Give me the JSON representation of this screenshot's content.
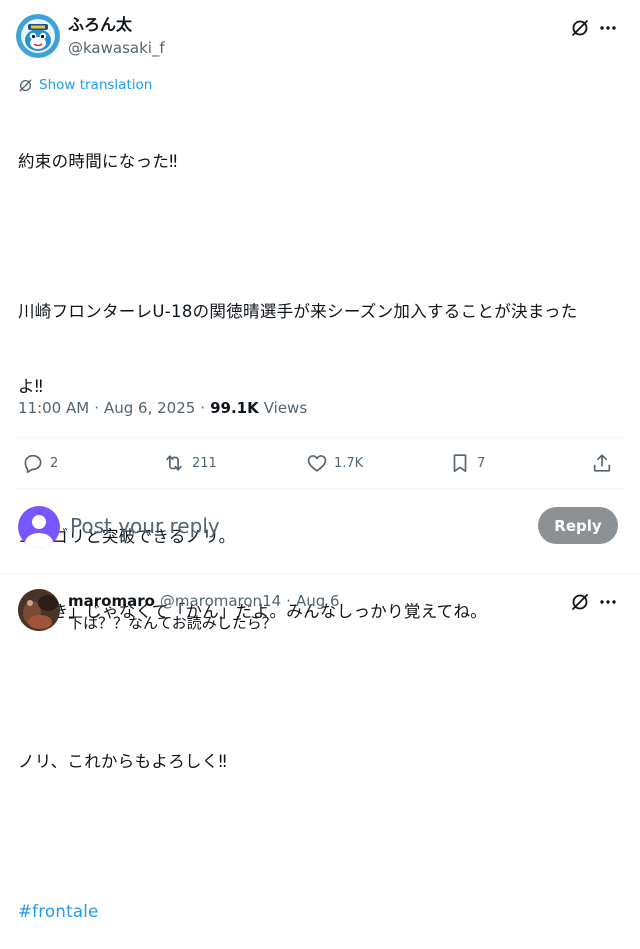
{
  "post": {
    "display_name": "ふろん太",
    "handle": "@kawasaki_f",
    "translate_label": "Show translation",
    "body_lines": [
      "約束の時間になった‼",
      "",
      "川崎フロンターレU-18の関徳晴選手が来シーズン加入することが決まった",
      "よ‼",
      "",
      "ゴリゴリと突破できるノリ。",
      "「せき」じゃなくて「かん」だよ。みんなしっかり覚えてね。",
      "",
      "ノリ、これからもよろしく‼"
    ],
    "hashtag": "#frontale",
    "time": "11:00 AM",
    "date": "Aug 6, 2025",
    "views_count": "99.1K",
    "views_label": "Views",
    "separator": "·"
  },
  "actions": {
    "replies": "2",
    "reposts": "211",
    "likes": "1.7K",
    "bookmarks": "7"
  },
  "composer": {
    "placeholder": "Post your reply",
    "button_label": "Reply"
  },
  "reply": {
    "display_name": "maromaro",
    "handle": "@maromaron14",
    "separator": "·",
    "date": "Aug 6",
    "text": "下は？？なんてお読みしたら？"
  },
  "colors": {
    "accent": "#1d9bf0",
    "muted": "#536471",
    "reply_button": "#8c9196",
    "composer_avatar": "#7856ff"
  },
  "icons": [
    "grok-icon",
    "more-icon",
    "translate-icon",
    "reply-icon",
    "repost-icon",
    "like-icon",
    "bookmark-icon",
    "share-icon"
  ]
}
